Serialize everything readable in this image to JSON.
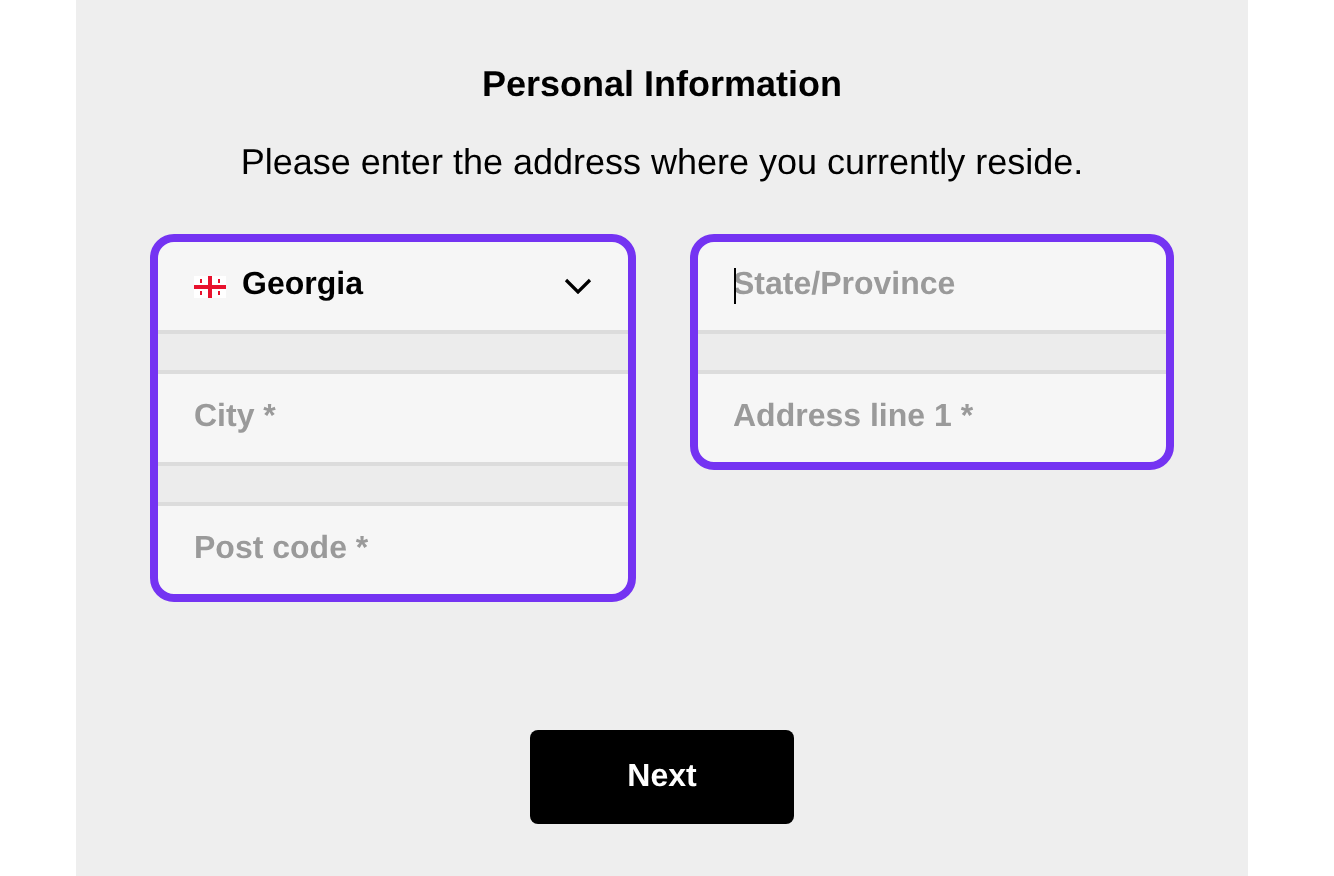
{
  "title": "Personal Information",
  "subtitle": "Please enter the address where you currently reside.",
  "groups": [
    {
      "fields": [
        {
          "kind": "select",
          "value": "Georgia"
        },
        {
          "kind": "input",
          "placeholder": "City *",
          "focused": false
        },
        {
          "kind": "input",
          "placeholder": "Post code *",
          "focused": false
        }
      ]
    },
    {
      "fields": [
        {
          "kind": "input",
          "placeholder": "State/Province",
          "focused": true
        },
        {
          "kind": "input",
          "placeholder": "Address line 1 *",
          "focused": false
        }
      ]
    }
  ],
  "next_button": "Next"
}
